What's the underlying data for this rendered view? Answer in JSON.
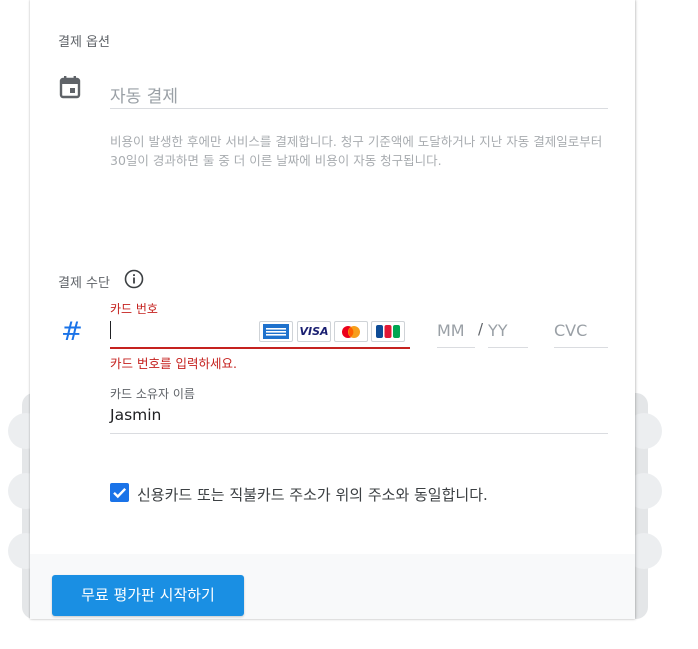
{
  "billing_options": {
    "section_title": "결제 옵션",
    "auto_pay_label": "자동 결제",
    "description": "비용이 발생한 후에만 서비스를 결제합니다. 청구 기준액에 도달하거나 지난 자동 결제일로부터 30일이 경과하면 둘 중 더 이른 날짜에 비용이 자동 청구됩니다."
  },
  "payment_method": {
    "section_title": "결제 수단",
    "card_number_label": "카드 번호",
    "card_number_value": "",
    "card_brands": [
      "amex-icon",
      "visa-icon",
      "mastercard-icon",
      "jcb-icon"
    ],
    "visa_text": "VISA",
    "expiry_month_placeholder": "MM",
    "expiry_separator": "/",
    "expiry_year_placeholder": "YY",
    "cvc_placeholder": "CVC",
    "card_number_error": "카드 번호를 입력하세요.",
    "cardholder_label": "카드 소유자 이름",
    "cardholder_value": "Jasmin",
    "same_address_checked": true,
    "same_address_label": "신용카드 또는 직불카드 주소가 위의 주소와 동일합니다."
  },
  "footer": {
    "start_trial_label": "무료 평가판 시작하기"
  },
  "colors": {
    "accent": "#1a73e8",
    "button": "#1a8fe3",
    "error": "#c5221f"
  }
}
